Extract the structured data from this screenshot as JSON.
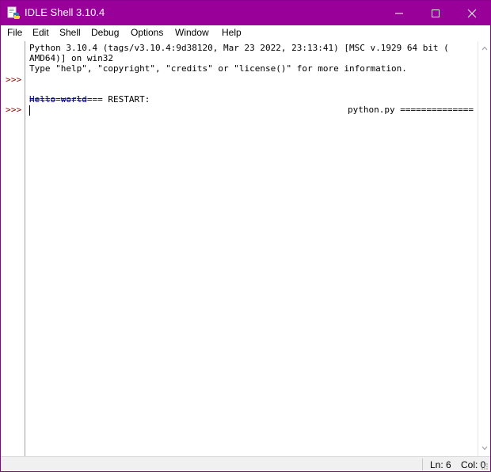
{
  "window": {
    "title": "IDLE Shell 3.10.4",
    "accent": "#99009a",
    "app_icon": "python-idle-icon"
  },
  "menu": {
    "items": [
      {
        "label": "File"
      },
      {
        "label": "Edit"
      },
      {
        "label": "Shell"
      },
      {
        "label": "Debug"
      },
      {
        "label": "Options"
      },
      {
        "label": "Window"
      },
      {
        "label": "Help"
      }
    ]
  },
  "gutter": {
    "prompts": [
      ">>>",
      ">>>"
    ],
    "prompt_color": "#9a0000"
  },
  "shell": {
    "banner_line1": "Python 3.10.4 (tags/v3.10.4:9d38120, Mar 23 2022, 23:13:41) [MSC v.1929 64 bit (",
    "banner_line2": "AMD64)] on win32",
    "banner_line3": "Type \"help\", \"copyright\", \"credits\" or \"license()\" for more information.",
    "restart_left": "============== RESTART:",
    "restart_right": "python.py ==============",
    "output_line": "Hello world",
    "output_color": "#0000c0"
  },
  "status": {
    "line": "Ln: 6",
    "column": "Col: 0"
  }
}
